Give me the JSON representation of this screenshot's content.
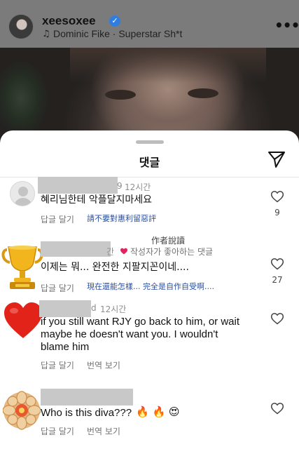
{
  "post": {
    "username": "xeesoxee",
    "verified": true,
    "song": "Dominic Fike · Superstar Sh*t",
    "music_icon": "♫",
    "more_icon": "•••"
  },
  "sheet": {
    "title": "댓글",
    "send_icon": "paper-plane-icon"
  },
  "comments": [
    {
      "username_suffix": "9",
      "time": "12시간",
      "text": "혜리님한테 악플달지마세요",
      "reply_label": "답글 달기",
      "translation": "請不要對惠利留惡評",
      "likes": "9",
      "avatar": "default-avatar"
    },
    {
      "author_label": "作者說讀",
      "time_partial": "간",
      "author_liked": "작성자가 좋아하는 댓글",
      "text": "이제는 뭐... 완전한 지팔지꼰이네....",
      "reply_label": "답글 달기",
      "translation": "現在還能怎樣... 完全是自作自受啊....",
      "likes": "27",
      "avatar": "trophy-avatar"
    },
    {
      "username_suffix": "d",
      "time": "12시간",
      "text_lines": [
        "if you still want RJY go back to him, or wait",
        "maybe he doesn't want you. I wouldn't",
        "blame him"
      ],
      "reply_label": "답글 달기",
      "translate_label": "번역 보기",
      "avatar": "heart-avatar"
    },
    {
      "text": "Who is this diva???",
      "emojis": "🔥 🔥 😍",
      "reply_label": "답글 달기",
      "translate_label": "번역 보기",
      "avatar": "flower-avatar"
    }
  ]
}
